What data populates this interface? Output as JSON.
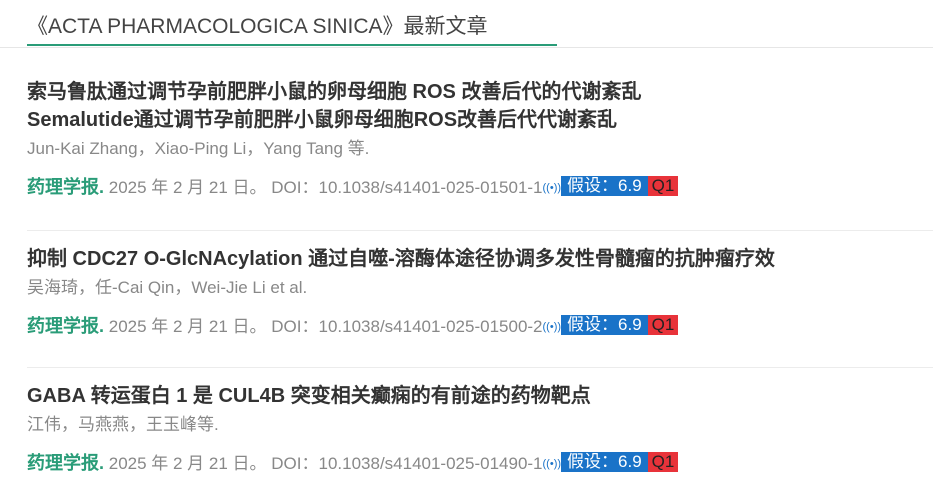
{
  "header": {
    "title": "《ACTA PHARMACOLOGICA SINICA》最新文章"
  },
  "articles": [
    {
      "title_cn": "索马鲁肽通过调节孕前肥胖小鼠的卵母细胞 ROS 改善后代的代谢紊乱",
      "title_en": "Semalutide通过调节孕前肥胖小鼠卵母细胞ROS改善后代代谢紊乱",
      "authors": "Jun-Kai Zhang，Xiao-Ping Li，Yang Tang 等.",
      "journal": "药理学报.",
      "date": " 2025 年 2 月 21 日。 ",
      "doi": "DOI：10.1038/s41401-025-01501-1",
      "signal_icon": "((•))",
      "if_label": "假设：6.9",
      "quartile": "Q1"
    },
    {
      "title_cn": "抑制 CDC27 O-GlcNAcylation 通过自噬-溶酶体途径协调多发性骨髓瘤的抗肿瘤疗效",
      "authors": "吴海琦，任-Cai Qin，Wei-Jie Li et al.",
      "journal": "药理学报.",
      "date": " 2025 年 2 月 21 日。 ",
      "doi": "DOI：10.1038/s41401-025-01500-2",
      "signal_icon": "((•))",
      "if_label": "假设：6.9",
      "quartile": "Q1"
    },
    {
      "title_cn": "GABA 转运蛋白 1 是 CUL4B 突变相关癫痫的有前途的药物靶点",
      "authors": "江伟，马燕燕，王玉峰等.",
      "journal": "药理学报.",
      "date": " 2025 年 2 月 21 日。 ",
      "doi": "DOI：10.1038/s41401-025-01490-1",
      "signal_icon": "((•))",
      "if_label": "假设：6.9",
      "quartile": "Q1"
    }
  ],
  "colors": {
    "accent_green": "#2a9c78",
    "if_blue": "#1a73c8",
    "quartile_red": "#e8333a"
  }
}
